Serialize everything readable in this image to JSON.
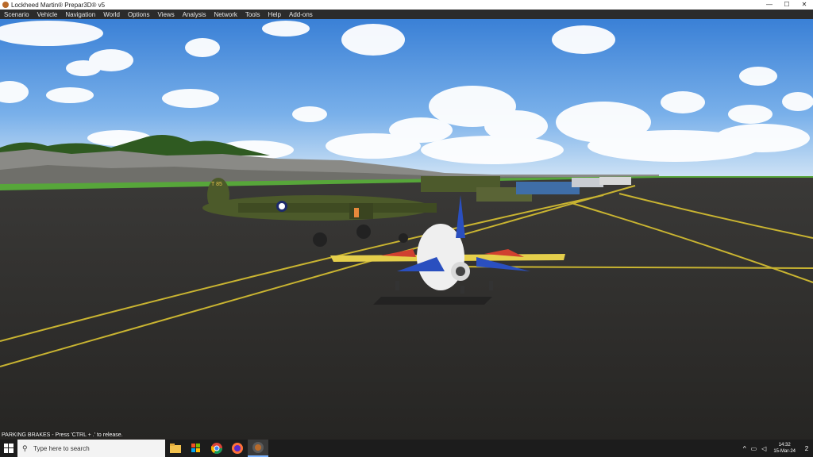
{
  "window": {
    "title": "Lockheed Martin® Prepar3D® v5",
    "minimize": "—",
    "maximize": "☐",
    "close": "✕"
  },
  "menu": [
    "Scenario",
    "Vehicle",
    "Navigation",
    "World",
    "Options",
    "Views",
    "Analysis",
    "Network",
    "Tools",
    "Help",
    "Add-ons"
  ],
  "viewport": {
    "status_message": "PARKING BRAKES - Press 'CTRL + .' to release.",
    "tail_code": "T 85"
  },
  "taskbar": {
    "search_placeholder": "Type here to search",
    "time": "14:32",
    "date": "15-Mar-24",
    "notification_count": "2"
  },
  "colors": {
    "sky_top": "#3f86d9",
    "tarmac": "#2f2e2c",
    "taxi_line": "#c9b431",
    "taskbar": "#1c1c1c"
  }
}
